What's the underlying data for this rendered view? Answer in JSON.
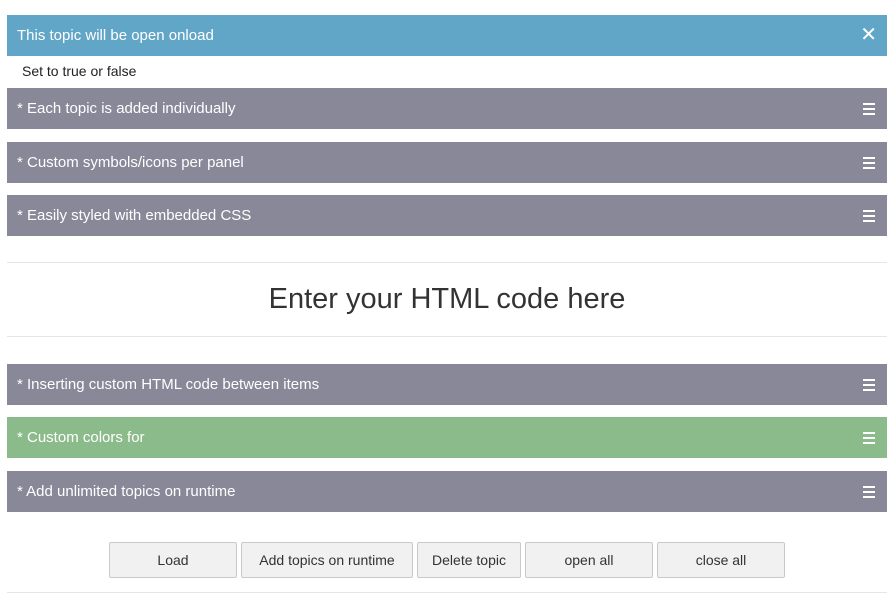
{
  "colors": {
    "open_header": "#62a6c7",
    "default_header": "#888899",
    "green_header": "#8bbb8b"
  },
  "panels": [
    {
      "title": "This topic will be open onload",
      "icon": "close-icon",
      "state": "open",
      "body": "Set to true or false"
    },
    {
      "title": "* Each topic is added individually",
      "icon": "hamburger-icon"
    },
    {
      "title": "* Custom symbols/icons per panel",
      "icon": "hamburger-icon"
    },
    {
      "title": "* Easily styled with embedded CSS",
      "icon": "hamburger-icon"
    },
    {
      "title": "* Inserting custom HTML code between items",
      "icon": "hamburger-icon"
    },
    {
      "title": "* Custom colors for",
      "icon": "hamburger-icon"
    },
    {
      "title": "* Add unlimited topics on runtime",
      "icon": "hamburger-icon"
    }
  ],
  "custom_html": "Enter your HTML code here",
  "buttons": {
    "load": "Load",
    "add_topics": "Add topics on runtime",
    "delete_topic": "Delete topic",
    "open_all": "open all",
    "close_all": "close all"
  }
}
